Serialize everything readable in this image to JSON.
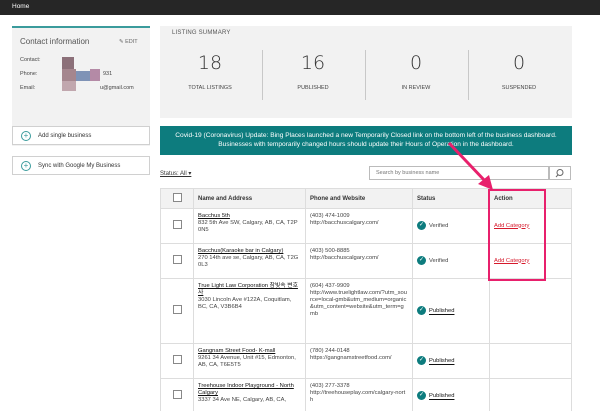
{
  "topbar": {
    "home": "Home"
  },
  "contact": {
    "title": "Contact information",
    "edit": "✎ EDIT",
    "labels": {
      "contact": "Contact:",
      "phone": "Phone:",
      "email": "Email:"
    },
    "phone_suffix": "931",
    "email_suffix": "u@gmail.com"
  },
  "sidebar": {
    "add_single": "Add single business",
    "sync_google": "Sync with Google My Business"
  },
  "summary": {
    "heading": "LISTING SUMMARY",
    "stats": [
      {
        "value": "18",
        "label": "TOTAL LISTINGS"
      },
      {
        "value": "16",
        "label": "PUBLISHED"
      },
      {
        "value": "0",
        "label": "IN REVIEW"
      },
      {
        "value": "0",
        "label": "SUSPENDED"
      }
    ]
  },
  "banner": "Covid-19 (Coronavirus) Update: Bing Places launched a new Temporarily Closed link on the bottom left of the business dashboard. Businesses with temporarily changed hours should update their Hours of Operation in the dashboard.",
  "filter": {
    "status": "Status: All ▾"
  },
  "search": {
    "placeholder": "Search by business name"
  },
  "table": {
    "headers": {
      "name": "Name and Address",
      "phone": "Phone and Website",
      "status": "Status",
      "action": "Action"
    },
    "rows": [
      {
        "name": "Bacchus 5th",
        "address": "832 5th Ave SW, Calgary, AB, CA, T2P 0N5",
        "phone": "(403) 474-1009",
        "website": "http://bacchuscalgary.com/",
        "status": "Verified",
        "action": "Add Category"
      },
      {
        "name": "Bacchus(Karaoke bar in Calgary)",
        "address": "270 14th ave se, Calgary, AB, CA, T2G 0L3",
        "phone": "(403) 500-8885",
        "website": "http://bacchuscalgary.com/",
        "status": "Verified",
        "action": "Add Category"
      },
      {
        "name": "True Light Law Corporation 참빛속 변호사",
        "address": "3030 Lincoln Ave #122A, Coquitlam, BC, CA, V3B6B4",
        "phone": "(604) 437-9909",
        "website": "http://www.truelightlaw.com/?utm_source=local-gmb&utm_medium=organic&utm_content=website&utm_term=gmb",
        "status": "Published",
        "action": ""
      },
      {
        "name": "Gangnam Street Food- K-mall",
        "address": "9261 34 Avenue, Unit #15, Edmonton, AB, CA, T6E5T5",
        "phone": "(780) 244-0148",
        "website": "https://gangnamstreetfood.com/",
        "status": "Published",
        "action": ""
      },
      {
        "name": "Treehouse Indoor Playground - North Calgary",
        "address": "3337 34 Ave NE, Calgary, AB, CA,",
        "phone": "(403) 277-3378",
        "website": "http://treehouseplay.com/calgary-north",
        "status": "Published",
        "action": ""
      }
    ]
  },
  "colors": {
    "accent": "#0d7c7e",
    "highlight": "#e8206c",
    "action": "#d6192b",
    "topbar": "#262626"
  }
}
